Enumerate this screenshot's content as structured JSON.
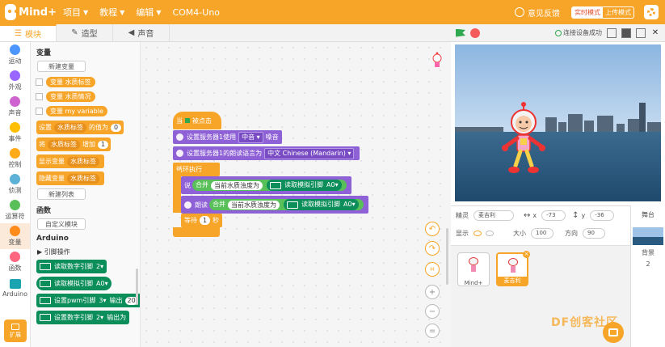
{
  "app": {
    "logo_text": "Mind+",
    "menus": [
      "项目",
      "教程",
      "编辑",
      "COM4-Uno"
    ],
    "feedback": "意见反馈",
    "modes": {
      "realtime": "实时模式",
      "upload": "上传模式"
    }
  },
  "tabs": [
    "模块",
    "造型",
    "声音"
  ],
  "categories": [
    {
      "label": "运动",
      "color": "#4c97ff"
    },
    {
      "label": "外观",
      "color": "#9966ff"
    },
    {
      "label": "声音",
      "color": "#cf63cf"
    },
    {
      "label": "事件",
      "color": "#ffbf00"
    },
    {
      "label": "控制",
      "color": "#ffab19"
    },
    {
      "label": "侦测",
      "color": "#5cb1d6"
    },
    {
      "label": "运算符",
      "color": "#59c059"
    },
    {
      "label": "变量",
      "color": "#ff8c1a"
    },
    {
      "label": "函数",
      "color": "#ff6680"
    },
    {
      "label": "Arduino",
      "color": "#1aa3b0"
    }
  ],
  "extension_label": "扩展",
  "palette": {
    "variables_title": "变量",
    "new_variable": "新建变量",
    "variables": [
      "变量 水质标签",
      "变量 水质情况",
      "变量 my variable"
    ],
    "set_block": {
      "verb": "设置",
      "var": "水质标签",
      "mid": "的值为",
      "value": "0"
    },
    "change_block": {
      "verb": "将",
      "var": "水质标签",
      "mid": "增加",
      "value": "1"
    },
    "show_block": {
      "verb": "显示变量",
      "var": "水质标签"
    },
    "hide_block": {
      "verb": "隐藏变量",
      "var": "水质标签"
    },
    "new_list": "新建列表",
    "functions_title": "函数",
    "custom_block": "自定义模块",
    "arduino_title": "Arduino",
    "pin_ops": "引脚操作",
    "digital_read": {
      "label": "读取数字引脚",
      "value": "2"
    },
    "analog_read": {
      "label": "读取模拟引脚",
      "value": "A0"
    },
    "pwm": {
      "label": "设置pwm引脚",
      "pin": "3",
      "out": "输出",
      "value": "20"
    },
    "digital_write": {
      "label": "设置数字引脚",
      "pin": "2",
      "out": "输出为"
    }
  },
  "script": {
    "hat": {
      "when": "当",
      "clicked": "被点击"
    },
    "server_use": {
      "label": "设置服务器1使用",
      "voice": "中音",
      "tail": "嗓音"
    },
    "server_lang": {
      "label": "设置服务器1的朗读语言为",
      "lang": "中文 Chinese (Mandarin)"
    },
    "loop": "循环执行",
    "say": {
      "verb": "说",
      "join": "合并",
      "text": "当前水质浊度为",
      "read": "读取模拟引脚",
      "pin": "A0"
    },
    "speak": {
      "verb": "朗读",
      "join": "合并",
      "text": "当前水质浊度为",
      "read": "读取模拟引脚",
      "pin": "A0"
    },
    "wait": {
      "verb": "等待",
      "value": "1",
      "unit": "秒"
    }
  },
  "stage_header": {
    "connected": "连接设备成功"
  },
  "sprite_info": {
    "sprite_label": "精灵",
    "sprite_name": "麦吉利",
    "x_label": "x",
    "x": "-73",
    "y_label": "y",
    "y": "-36",
    "show_label": "显示",
    "size_label": "大小",
    "size": "100",
    "dir_label": "方向",
    "dir": "90"
  },
  "sprites": [
    {
      "name": "Mind+",
      "active": false
    },
    {
      "name": "麦吉利",
      "active": true
    }
  ],
  "stage_panel": {
    "title": "舞台",
    "backdrop_label": "背景",
    "backdrop_count": "2"
  },
  "watermark": "DF创客社区"
}
